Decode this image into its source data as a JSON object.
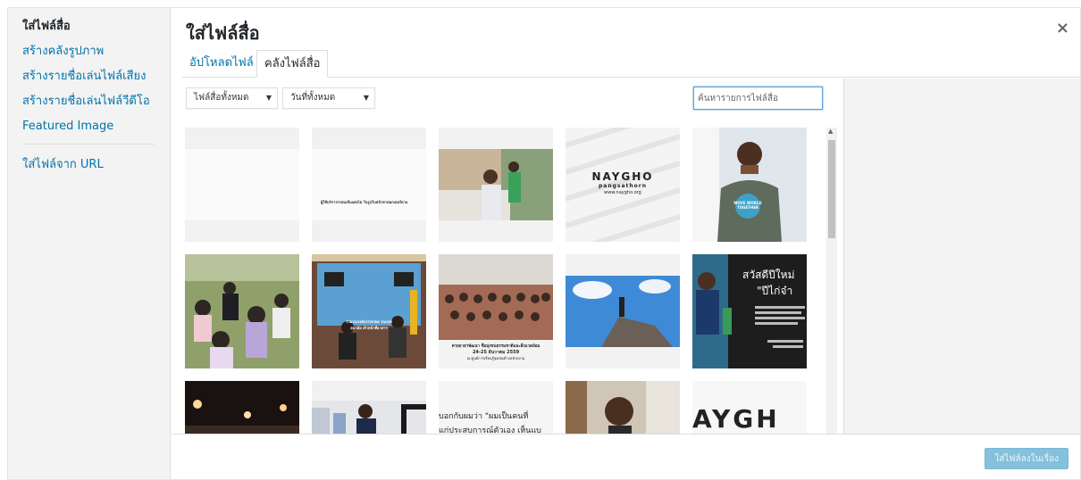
{
  "sidebar": {
    "items": [
      {
        "label": "ใส่ไฟล์สื่อ",
        "active": true
      },
      {
        "label": "สร้างคลังรูปภาพ"
      },
      {
        "label": "สร้างรายชื่อเล่นไฟล์เสียง"
      },
      {
        "label": "สร้างรายชื่อเล่นไฟล์วีดีโอ"
      },
      {
        "label": "Featured Image"
      }
    ],
    "url_item": {
      "label": "ใส่ไฟล์จาก URL"
    }
  },
  "header": {
    "title": "ใส่ไฟล์สื่อ",
    "close_icon": "×"
  },
  "tabs": [
    {
      "label": "อัปโหลดไฟล์"
    },
    {
      "label": "คลังไฟล์สื่อ",
      "active": true
    }
  ],
  "filters": {
    "type_select": "ไฟล์สื่อทั้งหมด",
    "date_select": "วันที่ทั้งหมด",
    "arrow": "▼"
  },
  "search": {
    "value": "ค้นหารายการไฟล์สื่อ"
  },
  "thumbs": {
    "t2_caption": "ผู้ใช้บริการกรอบเส้นแต่งไม่ ในรูปใบหน้าตาดอกเดอร์ตาแ",
    "t4_logo": "NAYGHO",
    "t4_sub": "pangsathorn",
    "t4_url": "www.naygho.org",
    "t5_badge": "MOVE WORLD TOGETHER",
    "t7_caption": "ร่วมรณรงค์บรรเทาผล รณรงค์อนามัย เจ้าหน้าที่อาสาฯ",
    "t8_caption1": "ค่ายอาสาพัฒนา ชื่อมุ่งชนธรรมชาติและสิ่งแวดล้อม",
    "t8_caption2": "24-25 ธันวาคม 2559",
    "t8_caption3": "ณ ศูนย์การเรียนรู้ชุมชนตำบลหัวยงาม",
    "t10_title1": "สวัสดีปีใหม่",
    "t10_title2": "\"ปีไก่จ๋า",
    "t13_line1": "บอกกับผมว่า \"ผมเป็นคนที่",
    "t13_line2": "แก่ประสบการณ์ตัวเอง เห็นแบ",
    "t15_text": "AYGH"
  },
  "footer": {
    "insert_label": "ใส่ไฟล์ลงในเรื่อง"
  },
  "colors": {
    "link": "#0073aa",
    "button": "#85c1dc",
    "sidebar_bg": "#f3f3f3"
  }
}
